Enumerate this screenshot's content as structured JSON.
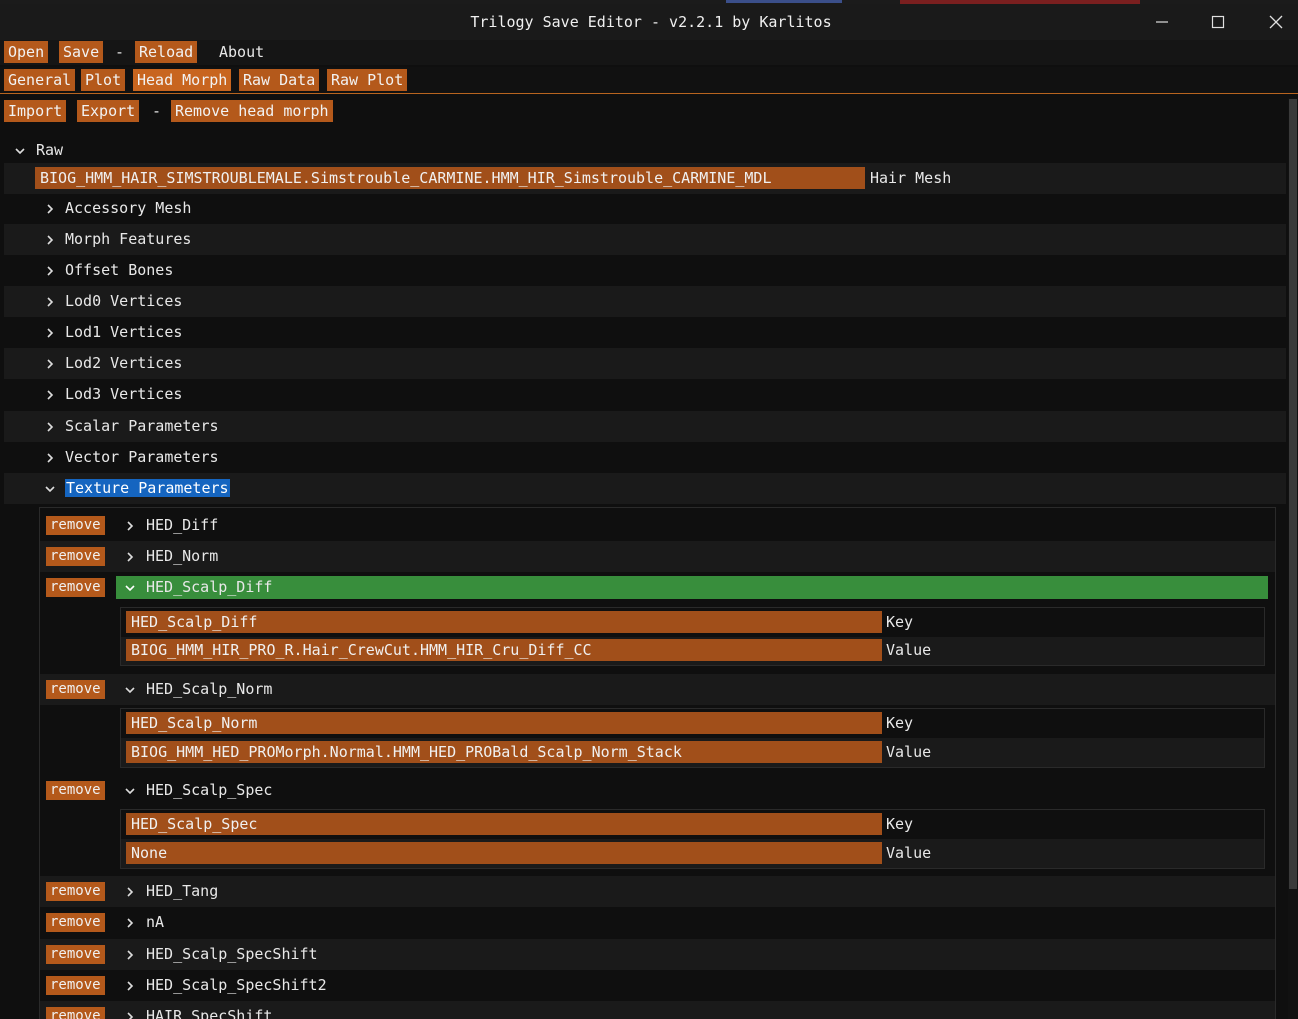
{
  "window": {
    "title": "Trilogy Save Editor - v2.2.1 by Karlitos"
  },
  "menu": {
    "open": "Open",
    "save": "Save",
    "sep": "-",
    "reload": "Reload",
    "about": "About"
  },
  "tabs": [
    "General",
    "Plot",
    "Head Morph",
    "Raw Data",
    "Raw Plot"
  ],
  "toolbar": {
    "import": "Import",
    "export": "Export",
    "sep": "-",
    "remove_head_morph": "Remove head morph"
  },
  "tree": {
    "root": "Raw",
    "hair_mesh_value": "BIOG_HMM_HAIR_SIMSTROUBLEMALE.Simstrouble_CARMINE.HMM_HIR_Simstrouble_CARMINE_MDL",
    "hair_mesh_label": "Hair Mesh",
    "sections": [
      "Accessory Mesh",
      "Morph Features",
      "Offset Bones",
      "Lod0 Vertices",
      "Lod1 Vertices",
      "Lod2 Vertices",
      "Lod3 Vertices",
      "Scalar Parameters",
      "Vector Parameters"
    ],
    "texture_params": "Texture Parameters",
    "remove_label": "remove",
    "key_label": "Key",
    "value_label": "Value",
    "items": [
      {
        "name": "HED_Diff"
      },
      {
        "name": "HED_Norm"
      },
      {
        "name": "HED_Scalp_Diff",
        "key": "HED_Scalp_Diff",
        "value": "BIOG_HMM_HIR_PRO_R.Hair_CrewCut.HMM_HIR_Cru_Diff_CC"
      },
      {
        "name": "HED_Scalp_Norm",
        "key": "HED_Scalp_Norm",
        "value": "BIOG_HMM_HED_PROMorph.Normal.HMM_HED_PROBald_Scalp_Norm_Stack"
      },
      {
        "name": "HED_Scalp_Spec",
        "key": "HED_Scalp_Spec",
        "value": "None"
      },
      {
        "name": "HED_Tang"
      },
      {
        "name": "nA"
      },
      {
        "name": "HED_Scalp_SpecShift"
      },
      {
        "name": "HED_Scalp_SpecShift2"
      },
      {
        "name": "HAIR_SpecShift"
      }
    ]
  },
  "colors": {
    "accent": "#b4591b",
    "selected": "#388e3c",
    "highlight": "#1565c0"
  }
}
